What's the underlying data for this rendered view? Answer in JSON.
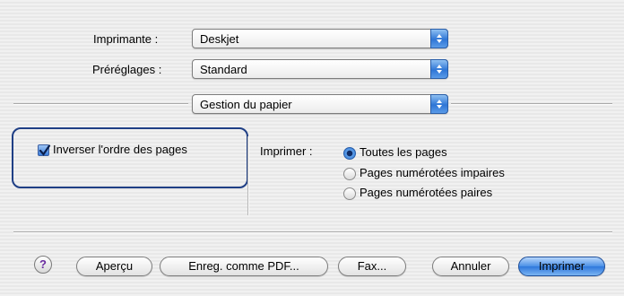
{
  "printer": {
    "label": "Imprimante :",
    "value": "Deskjet"
  },
  "presets": {
    "label": "Préréglages :",
    "value": "Standard"
  },
  "panel": {
    "value": "Gestion du papier"
  },
  "reverse_order": {
    "label": "Inverser l'ordre des pages",
    "checked": true
  },
  "print_pages": {
    "label": "Imprimer :",
    "options": [
      "Toutes les pages",
      "Pages numérotées impaires",
      "Pages numérotées paires"
    ],
    "selected": "Toutes les pages"
  },
  "buttons": {
    "help": "?",
    "preview": "Aperçu",
    "save_pdf": "Enreg. comme PDF...",
    "fax": "Fax...",
    "cancel": "Annuler",
    "print": "Imprimer"
  },
  "colors": {
    "accent": "#2f76d6",
    "highlight_border": "#1f3f85"
  }
}
